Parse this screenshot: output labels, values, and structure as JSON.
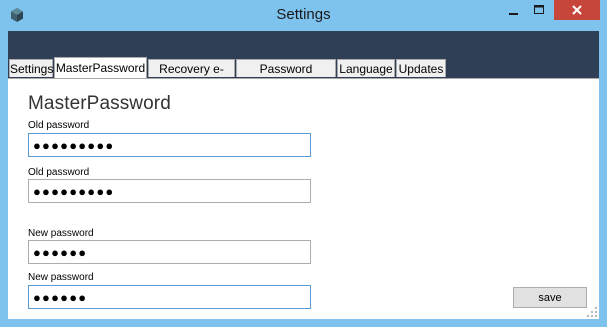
{
  "window": {
    "title": "Settings",
    "controls": {
      "minimize": "–",
      "maximize": "☐",
      "close": "✕"
    }
  },
  "tabs": [
    {
      "label": "Settings",
      "active": false
    },
    {
      "label": "MasterPassword",
      "active": true
    },
    {
      "label": "Recovery e-mail",
      "active": false
    },
    {
      "label": "Password recovery",
      "active": false
    },
    {
      "label": "Language",
      "active": false
    },
    {
      "label": "Updates",
      "active": false
    }
  ],
  "panel": {
    "title": "MasterPassword",
    "fields": [
      {
        "label": "Old password",
        "value": "●●●●●●●●●",
        "focused": true
      },
      {
        "label": "Old password",
        "value": "●●●●●●●●●",
        "focused": false
      },
      {
        "label": "New password",
        "value": "●●●●●●",
        "focused": false
      },
      {
        "label": "New password",
        "value": "●●●●●●",
        "focused": true
      }
    ],
    "save_label": "save"
  },
  "colors": {
    "titlebar": "#7ec2ee",
    "header_band": "#2f3f55",
    "close_button": "#c7463c"
  },
  "icons": {
    "app": "cube-icon",
    "resize": "resize-grip-icon"
  }
}
